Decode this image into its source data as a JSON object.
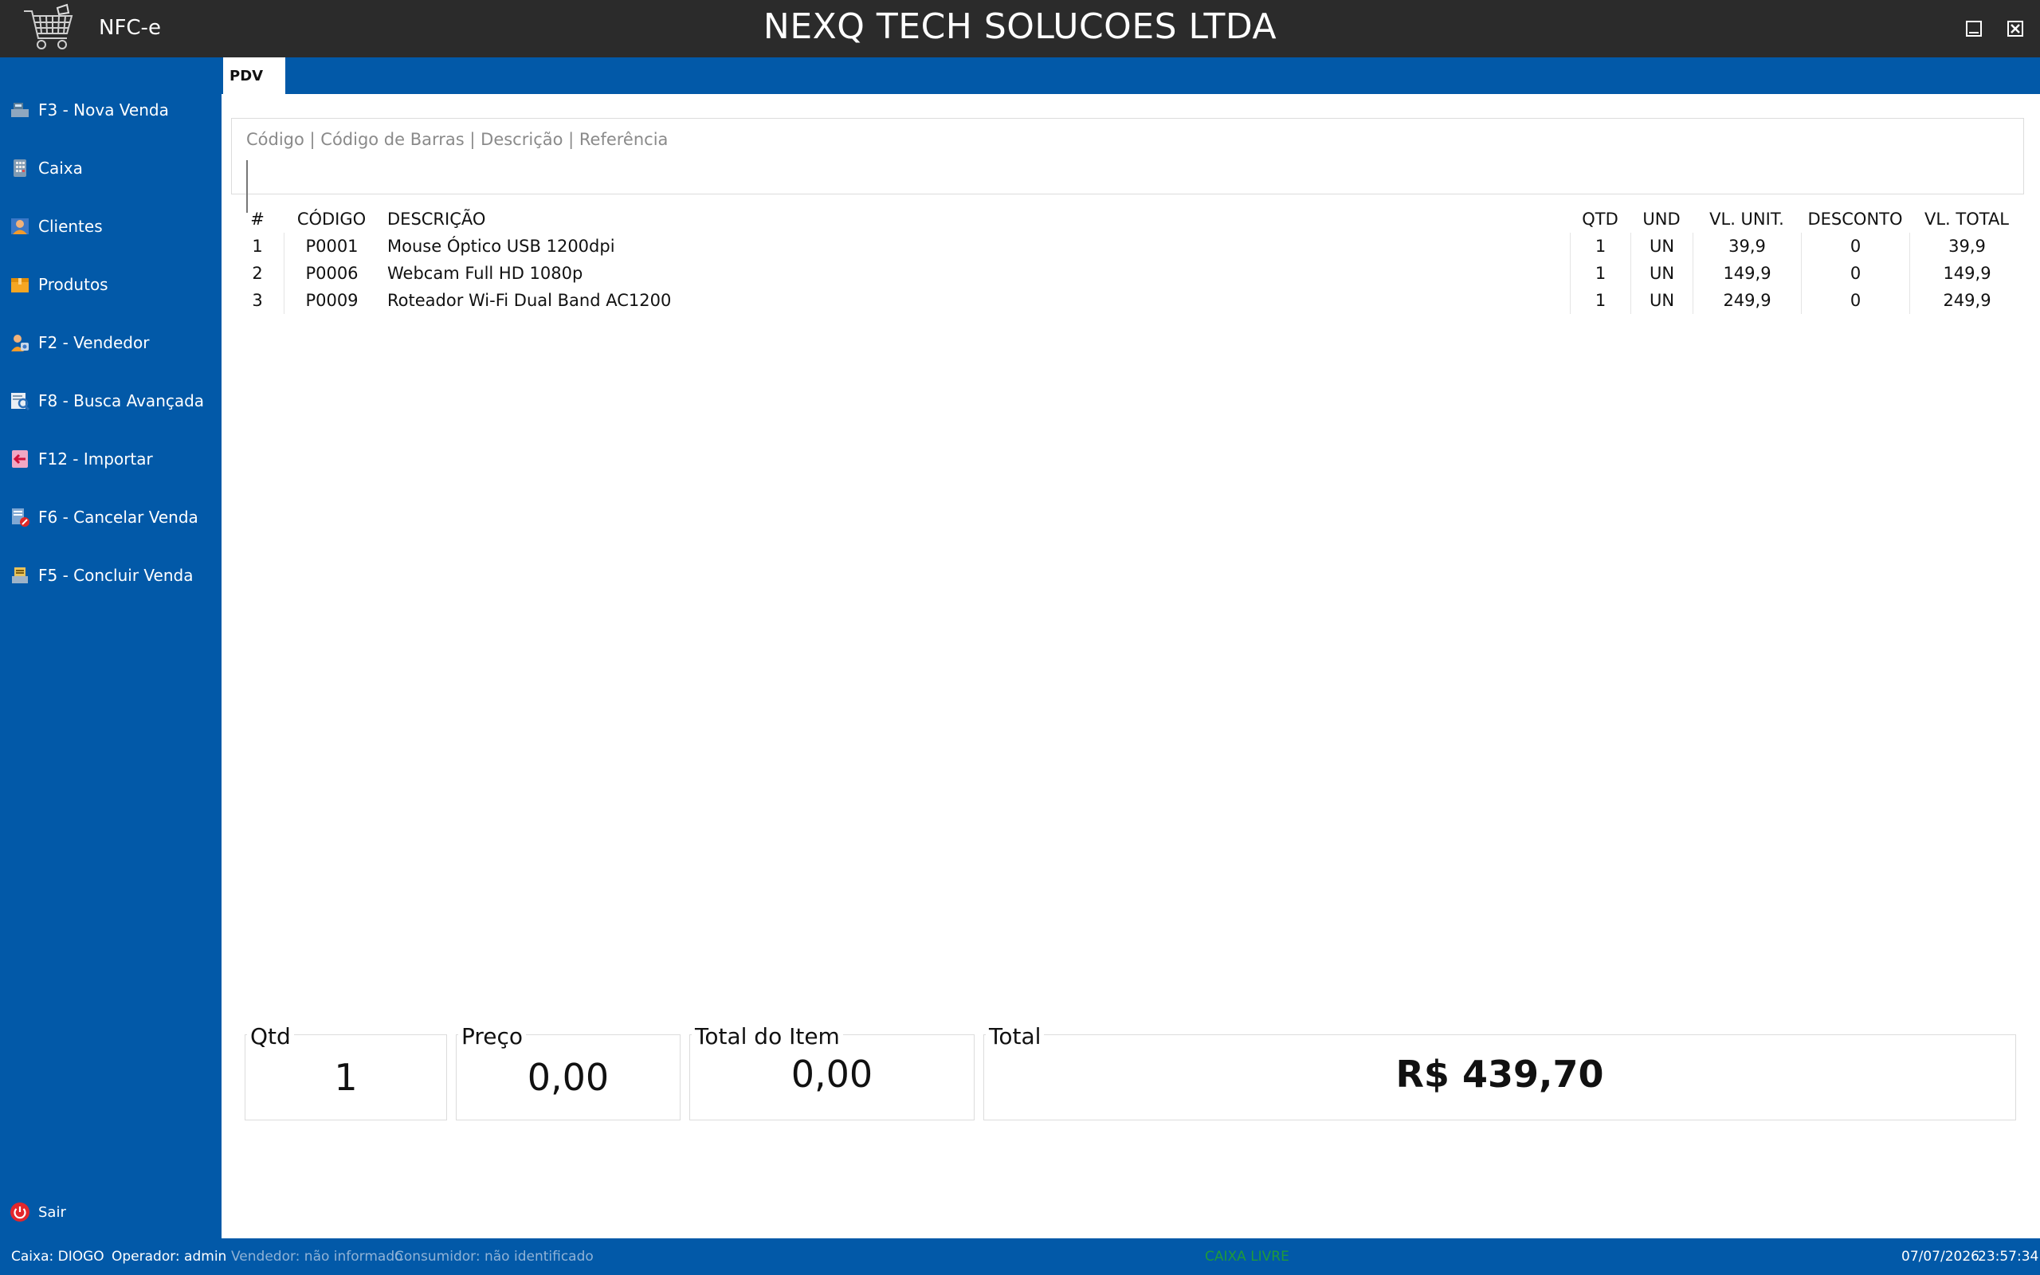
{
  "window": {
    "app_name": "NFC-e",
    "company": "NEXQ TECH SOLUCOES LTDA"
  },
  "sidebar": {
    "items": [
      {
        "label": "F3 - Nova Venda",
        "icon": "register-icon"
      },
      {
        "label": "Caixa",
        "icon": "calculator-icon"
      },
      {
        "label": "Clientes",
        "icon": "person-icon"
      },
      {
        "label": "Produtos",
        "icon": "box-icon"
      },
      {
        "label": "F2 - Vendedor",
        "icon": "seller-icon"
      },
      {
        "label": "F8 - Busca Avançada",
        "icon": "search-icon"
      },
      {
        "label": "F12 - Importar",
        "icon": "import-icon"
      },
      {
        "label": "F6 - Cancelar Venda",
        "icon": "cancel-sale-icon"
      },
      {
        "label": "F5 - Concluir Venda",
        "icon": "finish-sale-icon"
      }
    ],
    "exit_label": "Sair"
  },
  "tabs": [
    {
      "label": "PDV"
    }
  ],
  "search": {
    "legend": "Código | Código de Barras | Descrição | Referência",
    "value": ""
  },
  "table": {
    "headers": {
      "num": "#",
      "codigo": "CÓDIGO",
      "descricao": "DESCRIÇÃO",
      "qtd": "QTD",
      "und": "UND",
      "vl_unit": "VL. UNIT.",
      "desconto": "DESCONTO",
      "vl_total": "VL. TOTAL"
    },
    "rows": [
      {
        "num": "1",
        "codigo": "P0001",
        "descricao": "Mouse Óptico USB 1200dpi",
        "qtd": "1",
        "und": "UN",
        "vl_unit": "39,9",
        "desconto": "0",
        "vl_total": "39,9"
      },
      {
        "num": "2",
        "codigo": "P0006",
        "descricao": "Webcam Full HD 1080p",
        "qtd": "1",
        "und": "UN",
        "vl_unit": "149,9",
        "desconto": "0",
        "vl_total": "149,9"
      },
      {
        "num": "3",
        "codigo": "P0009",
        "descricao": "Roteador Wi-Fi Dual Band AC1200",
        "qtd": "1",
        "und": "UN",
        "vl_unit": "249,9",
        "desconto": "0",
        "vl_total": "249,9"
      }
    ]
  },
  "summary": {
    "qtd_label": "Qtd",
    "qtd_value": "1",
    "preco_label": "Preço",
    "preco_value": "0,00",
    "total_item_label": "Total do Item",
    "total_item_value": "0,00",
    "total_label": "Total",
    "total_value": "R$ 439,70"
  },
  "status": {
    "caixa": "Caixa: DIOGO",
    "operador": "Operador: admin",
    "vendedor": "Vendedor: não informado",
    "consumidor": "Consumidor: não identificado",
    "caixa_status": "CAIXA LIVRE",
    "date": "07/07/2026",
    "time": "23:57:34"
  },
  "colors": {
    "primary_blue": "#0259a8",
    "titlebar": "#2b2b2b",
    "status_green": "#1f9a3a",
    "muted_text": "#8fb2d6"
  }
}
